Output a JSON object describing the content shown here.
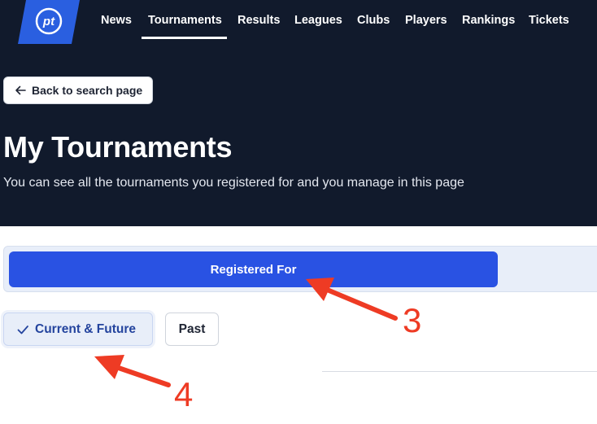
{
  "header": {
    "logo_text": "pt",
    "nav": [
      {
        "label": "News"
      },
      {
        "label": "Tournaments"
      },
      {
        "label": "Results"
      },
      {
        "label": "Leagues"
      },
      {
        "label": "Clubs"
      },
      {
        "label": "Players"
      },
      {
        "label": "Rankings"
      },
      {
        "label": "Tickets"
      }
    ],
    "active_nav": "Tournaments"
  },
  "back_button": {
    "label": "Back to search page",
    "icon": "arrow-left-icon"
  },
  "page": {
    "title": "My Tournaments",
    "subtitle": "You can see all the tournaments you registered for and you manage in this page"
  },
  "tabs": {
    "active_label": "Registered For"
  },
  "filters": {
    "current": {
      "label": "Current & Future",
      "icon": "check-icon",
      "selected": true
    },
    "past": {
      "label": "Past",
      "selected": false
    }
  },
  "annotations": [
    {
      "label": "3"
    },
    {
      "label": "4"
    }
  ],
  "colors": {
    "hero_bg": "#111a2c",
    "logo_blue": "#2a5fe0",
    "primary": "#2952e3",
    "tab_bar_bg": "#e8eef9",
    "annotation_red": "#ee3b24"
  }
}
